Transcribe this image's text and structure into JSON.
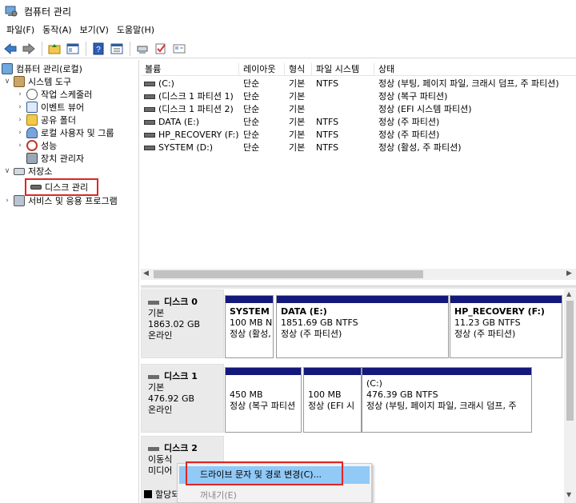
{
  "window": {
    "title": "컴퓨터 관리"
  },
  "menu": [
    "파일(F)",
    "동작(A)",
    "보기(V)",
    "도움말(H)"
  ],
  "toolbar": [
    "back-arrow-icon",
    "forward-arrow-icon",
    "up-folder-icon",
    "show-tree-icon",
    "help-icon",
    "properties-icon",
    "connect-icon",
    "check-icon",
    "window-icon"
  ],
  "tree": {
    "root": "컴퓨터 관리(로컬)",
    "system_tools": "시스템 도구",
    "task_scheduler": "작업 스케줄러",
    "event_viewer": "이벤트 뷰어",
    "shared_folders": "공유 폴더",
    "local_users": "로컬 사용자 및 그룹",
    "performance": "성능",
    "device_manager": "장치 관리자",
    "storage": "저장소",
    "disk_management": "디스크 관리",
    "services_apps": "서비스 및 응용 프로그램"
  },
  "volumes": {
    "headers": [
      "볼륨",
      "레이아웃",
      "형식",
      "파일 시스템",
      "상태"
    ],
    "rows": [
      {
        "name": "(C:)",
        "layout": "단순",
        "type": "기본",
        "fs": "NTFS",
        "status": "정상 (부팅, 페이지 파일, 크래시 덤프, 주 파티션)"
      },
      {
        "name": "(디스크 1 파티션 1)",
        "layout": "단순",
        "type": "기본",
        "fs": "",
        "status": "정상 (복구 파티션)"
      },
      {
        "name": "(디스크 1 파티션 2)",
        "layout": "단순",
        "type": "기본",
        "fs": "",
        "status": "정상 (EFI 시스템 파티션)"
      },
      {
        "name": "DATA (E:)",
        "layout": "단순",
        "type": "기본",
        "fs": "NTFS",
        "status": "정상 (주 파티션)"
      },
      {
        "name": "HP_RECOVERY (F:)",
        "layout": "단순",
        "type": "기본",
        "fs": "NTFS",
        "status": "정상 (주 파티션)"
      },
      {
        "name": "SYSTEM (D:)",
        "layout": "단순",
        "type": "기본",
        "fs": "NTFS",
        "status": "정상 (활성, 주 파티션)"
      }
    ]
  },
  "disks": [
    {
      "name": "디스크 0",
      "kind": "기본",
      "size": "1863.02 GB",
      "state": "온라인",
      "partitions": [
        {
          "title": "SYSTEM  (",
          "line2": "100 MB N",
          "line3": "정상 (활성,",
          "titled": true
        },
        {
          "title": "DATA  (E:)",
          "line2": "1851.69 GB NTFS",
          "line3": "정상 (주 파티션)",
          "titled": true
        },
        {
          "title": "HP_RECOVERY  (F:)",
          "line2": "11.23 GB NTFS",
          "line3": "정상 (주 파티션)",
          "titled": true
        }
      ]
    },
    {
      "name": "디스크 1",
      "kind": "기본",
      "size": "476.92 GB",
      "state": "온라인",
      "partitions": [
        {
          "title": "",
          "line2": "450 MB",
          "line3": "정상 (복구 파티션",
          "titled": false
        },
        {
          "title": "",
          "line2": "100 MB",
          "line3": "정상 (EFI 시",
          "titled": false
        },
        {
          "title": "(C:)",
          "line2": "476.39 GB NTFS",
          "line3": "정상 (부팅, 페이지 파일, 크래시 덤프, 주",
          "titled": false
        }
      ]
    },
    {
      "name": "디스크 2",
      "kind": "이동식",
      "size": "",
      "state": "미디어",
      "partitions": []
    }
  ],
  "legend": {
    "label": "할당되"
  },
  "context_menu": {
    "change_drive_letter": "드라이브 문자 및 경로 변경(C)...",
    "eject": "꺼내기(E)"
  }
}
